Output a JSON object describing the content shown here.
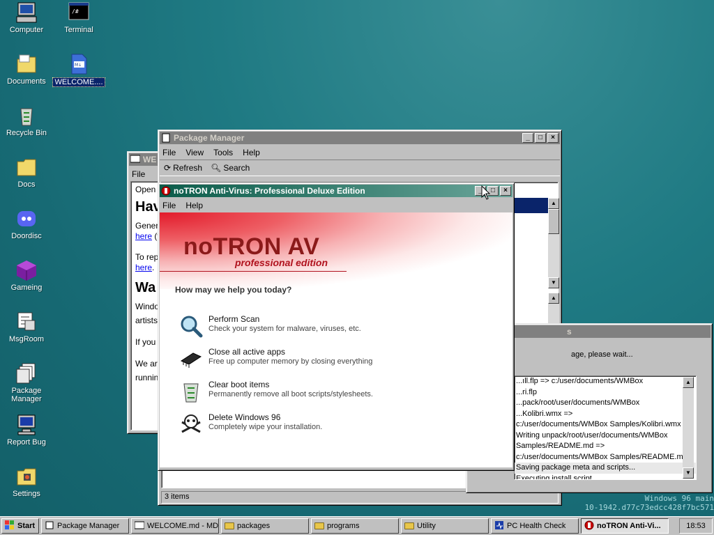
{
  "desktop": {
    "icons": [
      {
        "label": "Computer"
      },
      {
        "label": "Terminal"
      },
      {
        "label": "Documents"
      },
      {
        "label": "WELCOME...."
      },
      {
        "label": "Recycle Bin"
      },
      {
        "label": "Docs"
      },
      {
        "label": "Doordisc"
      },
      {
        "label": "Gameing"
      },
      {
        "label": "MsgRoom"
      },
      {
        "label": "Package Manager"
      },
      {
        "label": "Report Bug"
      },
      {
        "label": "Settings"
      }
    ],
    "watermark_line1": "Windows 96 main",
    "watermark_line2": "10-1942.d77c73edcc428f7bc571"
  },
  "welcome_window": {
    "title": "WE",
    "menu": [
      "File"
    ],
    "lines": [
      "Open",
      "Hav",
      "Gener",
      "here",
      "(t",
      "To rep",
      "here",
      ".",
      "Wa",
      "Windo",
      "artists",
      "If you",
      "We are",
      "runnin"
    ]
  },
  "package_manager": {
    "title": "Package Manager",
    "menu": [
      "File",
      "View",
      "Tools",
      "Help"
    ],
    "toolbar": {
      "refresh_label": "Refresh",
      "search_label": "Search"
    },
    "status": "3 items"
  },
  "install_window": {
    "title": "s",
    "status_text": "age, please wait...",
    "log": [
      "...ıll.flp => c:/user/documents/WMBox",
      "...ri.flp",
      "...pack/root/user/documents/WMBox",
      "...Kolibri.wmx =>",
      "c:/user/documents/WMBox Samples/Kolibri.wmx",
      "Writing unpack/root/user/documents/WMBox",
      "Samples/README.md =>",
      "c:/user/documents/WMBox Samples/README.md",
      "Saving package meta and scripts...",
      "Executing install script..."
    ]
  },
  "notron": {
    "title": "noTRON Anti-Virus: Professional Deluxe Edition",
    "menu": [
      "File",
      "Help"
    ],
    "brand": "noTRON AV",
    "edition": "professional edition",
    "question": "How may we help you today?",
    "actions": [
      {
        "title": "Perform Scan",
        "desc": "Check your system for malware, viruses, etc.",
        "icon": "magnifier-icon"
      },
      {
        "title": "Close all active apps",
        "desc": "Free up computer memory by closing everything",
        "icon": "memory-chip-icon"
      },
      {
        "title": "Clear boot items",
        "desc": "Permanently remove all boot scripts/stylesheets.",
        "icon": "recycle-bin-icon"
      },
      {
        "title": "Delete Windows 96",
        "desc": "Completely wipe your installation.",
        "icon": "skull-icon"
      }
    ]
  },
  "taskbar": {
    "start_label": "Start",
    "tasks": [
      {
        "label": "Package Manager",
        "pressed": false
      },
      {
        "label": "WELCOME.md - MD...",
        "pressed": false
      },
      {
        "label": "packages",
        "pressed": false
      },
      {
        "label": "programs",
        "pressed": false
      },
      {
        "label": "Utility",
        "pressed": false
      },
      {
        "label": "PC Health Check",
        "pressed": false
      },
      {
        "label": "noTRON Anti-Vi...",
        "pressed": true
      }
    ],
    "clock": "18:53"
  },
  "colors": {
    "desktop": "#1f7a83",
    "brand_red": "#b0121e",
    "title_active": "#0b5c4a"
  }
}
